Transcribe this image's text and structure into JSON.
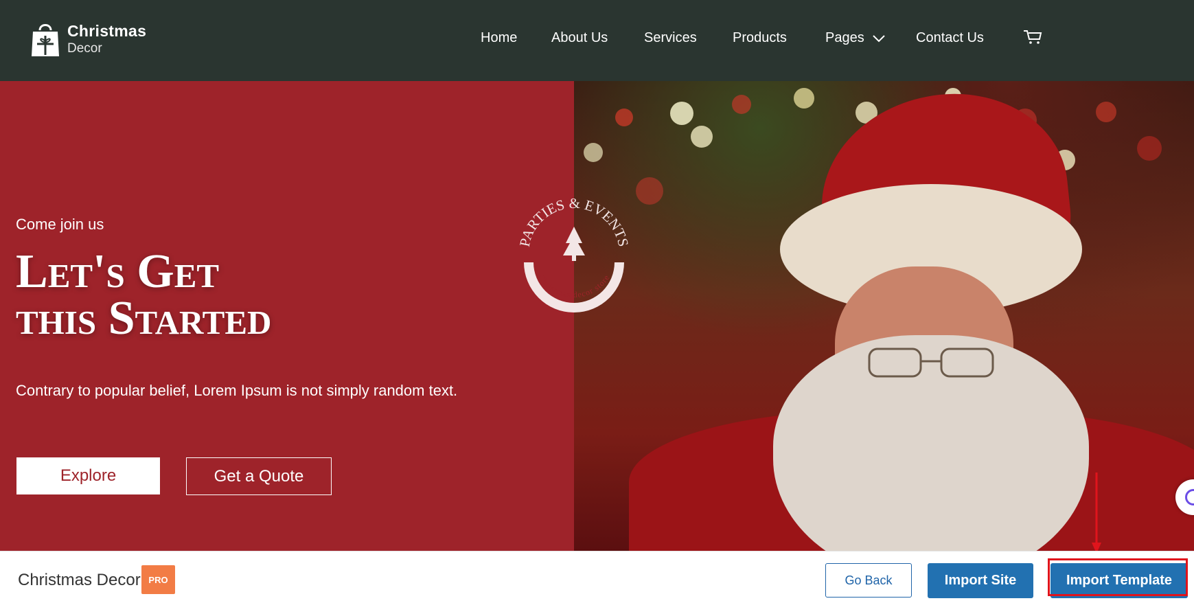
{
  "header": {
    "logo": {
      "title": "Christmas",
      "subtitle": "Decor"
    },
    "nav": [
      {
        "label": "Home"
      },
      {
        "label": "About Us"
      },
      {
        "label": "Services"
      },
      {
        "label": "Products"
      },
      {
        "label": "Pages"
      },
      {
        "label": "Contact Us"
      }
    ],
    "colors": {
      "background": "#2a3530"
    }
  },
  "hero": {
    "kicker": "Come join us",
    "headline_line1": "Let's Get",
    "headline_line2": "this Started",
    "description": "Contrary to popular belief, Lorem Ipsum is not simply random text.",
    "explore_label": "Explore",
    "quote_label": "Get a Quote",
    "badge_top": "PARTIES & EVENTS",
    "badge_bottom": "Christmas decor store",
    "colors": {
      "panel": "#9e232a"
    }
  },
  "footer_bar": {
    "site_name": "Christmas Decor",
    "pro_badge": "PRO",
    "go_back_label": "Go Back",
    "import_site_label": "Import Site",
    "import_template_label": "Import Template",
    "colors": {
      "primary": "#2271b1",
      "pro": "#f27c45",
      "highlight": "#e0141c"
    }
  },
  "icons": [
    "gift-bag-icon",
    "chevron-down-icon",
    "cart-icon",
    "chat-widget-icon",
    "tree-icon",
    "arrow-down-icon"
  ]
}
